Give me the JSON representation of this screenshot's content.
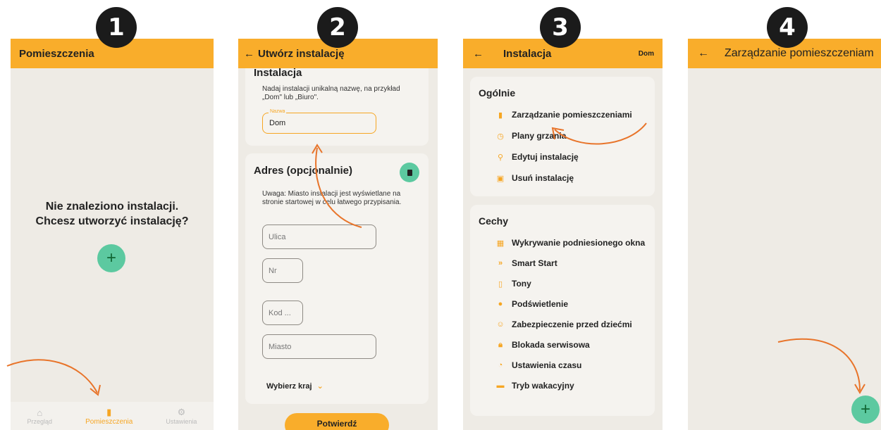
{
  "badges": [
    "1",
    "2",
    "3",
    "4"
  ],
  "screen1": {
    "title": "Pomieszczenia",
    "empty_line1": "Nie znaleziono instalacji.",
    "empty_line2": "Chcesz utworzyć instalację?",
    "fab": "+",
    "nav": [
      {
        "label": "Przegląd",
        "icon": "home-icon"
      },
      {
        "label": "Pomieszczenia",
        "icon": "door-icon"
      },
      {
        "label": "Ustawienia",
        "icon": "gear-icon"
      }
    ]
  },
  "screen2": {
    "back": "←",
    "title": "Utwórz instalację",
    "section1_title": "Instalacja",
    "section1_desc": "Nadaj instalacji unikalną nazwę, na przykład „Dom\" lub „Biuro\".",
    "name_label": "Nazwa",
    "name_value": "Dom",
    "section2_title": "Adres (opcjonalnie)",
    "section2_desc": "Uwaga: Miasto instalacji jest wyświetlane na stronie startowej w celu łatwego przypisania.",
    "street_placeholder": "Ulica",
    "nr_placeholder": "Nr",
    "zip_placeholder": "Kod ...",
    "city_placeholder": "Miasto",
    "country_label": "Wybierz kraj",
    "confirm": "Potwierdź"
  },
  "screen3": {
    "back": "←",
    "title": "Instalacja",
    "right": "Dom",
    "general_title": "Ogólnie",
    "general_items": [
      {
        "label": "Zarządzanie pomieszczeniami",
        "icon": "door-icon"
      },
      {
        "label": "Plany grzania",
        "icon": "clock-icon"
      },
      {
        "label": "Edytuj instalację",
        "icon": "location-pin-icon"
      },
      {
        "label": "Usuń instalację",
        "icon": "trash-icon"
      }
    ],
    "features_title": "Cechy",
    "features": [
      {
        "label": "Wykrywanie podniesionego okna",
        "icon": "window-icon"
      },
      {
        "label": "Smart Start",
        "icon": "double-chevron-icon"
      },
      {
        "label": "Tony",
        "icon": "speaker-icon"
      },
      {
        "label": "Podświetlenie",
        "icon": "bulb-icon"
      },
      {
        "label": "Zabezpieczenie przed dziećmi",
        "icon": "child-face-icon"
      },
      {
        "label": "Blokada serwisowa",
        "icon": "lock-icon"
      },
      {
        "label": "Ustawienia czasu",
        "icon": "stopwatch-icon"
      },
      {
        "label": "Tryb wakacyjny",
        "icon": "suitcase-icon"
      }
    ]
  },
  "screen4": {
    "back": "←",
    "title": "Zarządzanie pomieszczeniam",
    "fab": "+"
  },
  "colors": {
    "accent": "#f9ad2b",
    "fab": "#5cc9a0",
    "background": "#eeebe5",
    "arrow": "#e8742a"
  }
}
